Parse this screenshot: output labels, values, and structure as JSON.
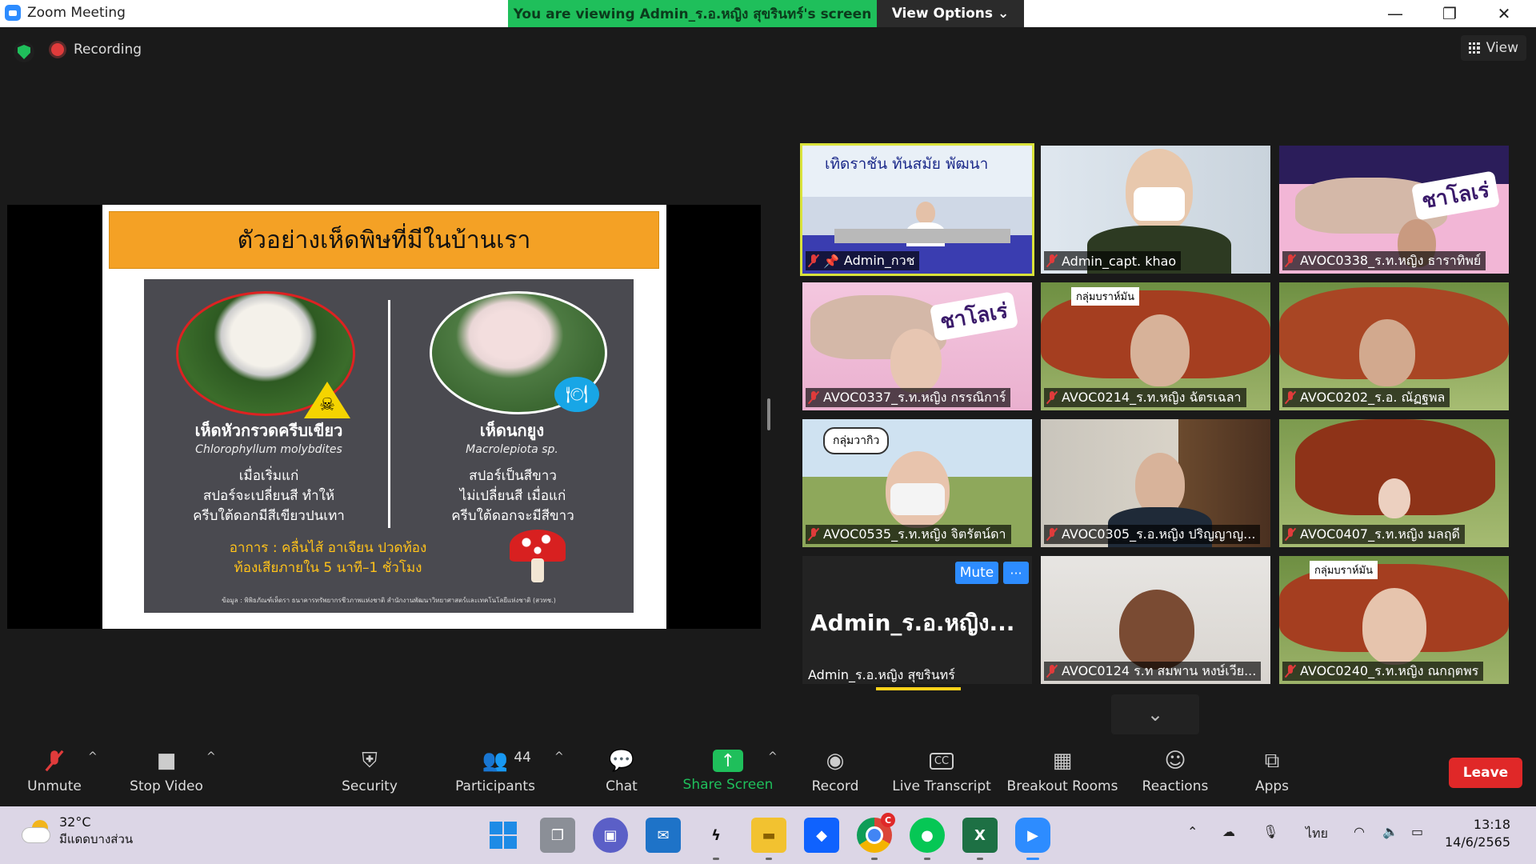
{
  "window": {
    "title": "Zoom Meeting"
  },
  "share_banner": {
    "text": "You are viewing Admin_ร.อ.หญิง สุขรินทร์'s screen",
    "view_options": "View Options"
  },
  "top": {
    "recording": "Recording",
    "view": "View"
  },
  "slide": {
    "title": "ตัวอย่างเห็ดพิษที่มีในบ้านเรา",
    "left_name": "เห็ดหัวกรวดครีบเขียว",
    "left_latin": "Chlorophyllum molybdites",
    "left_desc_1": "เมื่อเริ่มแก่",
    "left_desc_2": "สปอร์จะเปลี่ยนสี ทำให้",
    "left_desc_3": "ครีบใต้ดอกมีสีเขียวปนเทา",
    "right_name": "เห็ดนกยูง",
    "right_latin": "Macrolepiota sp.",
    "right_desc_1": "สปอร์เป็นสีขาว",
    "right_desc_2": "ไม่เปลี่ยนสี เมื่อแก่",
    "right_desc_3": "ครีบใต้ดอกจะมีสีขาว",
    "symptom_1": "อาการ : คลื่นไส้ อาเจียน ปวดท้อง",
    "symptom_2": "ท้องเสียภายใน 5 นาที–1 ชั่วโมง",
    "source": "ข้อมูล : พิพิธภัณฑ์เห็ดรา ธนาคารทรัพยากรชีวภาพแห่งชาติ สำนักงานพัฒนาวิทยาศาสตร์และเทคโนโลยีแห่งชาติ (สวทช.)"
  },
  "participants": [
    {
      "name": "Admin_กวช",
      "sign": "เทิดราชัน ทันสมัย พัฒนา"
    },
    {
      "name": "Admin_capt. khao"
    },
    {
      "name": "AVOC0338_ร.ท.หญิง ธาราทิพย์",
      "sign": "ชาโลเร่"
    },
    {
      "name": "AVOC0337_ร.ท.หญิง กรรณิการ์",
      "sign": "ชาโลเร่"
    },
    {
      "name": "AVOC0214_ร.ท.หญิง ฉัตรเฉลา",
      "sign": "กลุ่มบราห์มัน"
    },
    {
      "name": "AVOC0202_ร.อ. ณัฏฐพล"
    },
    {
      "name": "AVOC0535_ร.ท.หญิง จิตรัตน์ดา",
      "sign": "กลุ่มวากิว"
    },
    {
      "name": "AVOC0305_ร.อ.หญิง ปริญญาญ..."
    },
    {
      "name": "AVOC0407_ร.ท.หญิง มลฤดี"
    },
    {
      "name": "AVOC0124 ร.ท สมพาน หงษ์เวีย..."
    },
    {
      "name": "AVOC0240_ร.ท.หญิง ณกฤตพร",
      "sign": "กลุ่มบราห์มัน"
    }
  ],
  "admin_tile": {
    "big": "Admin_ร.อ.หญิง...",
    "name": "Admin_ร.อ.หญิง สุขรินทร์",
    "mute": "Mute",
    "more": "···"
  },
  "toolbar": {
    "unmute": "Unmute",
    "stop_video": "Stop Video",
    "security": "Security",
    "participants": "Participants",
    "participants_count": "44",
    "chat": "Chat",
    "share_screen": "Share Screen",
    "record": "Record",
    "live_transcript": "Live Transcript",
    "breakout_rooms": "Breakout Rooms",
    "reactions": "Reactions",
    "apps": "Apps",
    "leave": "Leave",
    "cc": "CC"
  },
  "taskbar": {
    "temp": "32°C",
    "weather": "มีแดดบางส่วน",
    "lang": "ไทย",
    "time": "13:18",
    "date": "14/6/2565",
    "chrome_badge": "C"
  },
  "colors": {
    "accent": "#2d8cff",
    "green": "#1fbf5b",
    "leave": "#e02828",
    "slide_title_bg": "#f4a125"
  }
}
